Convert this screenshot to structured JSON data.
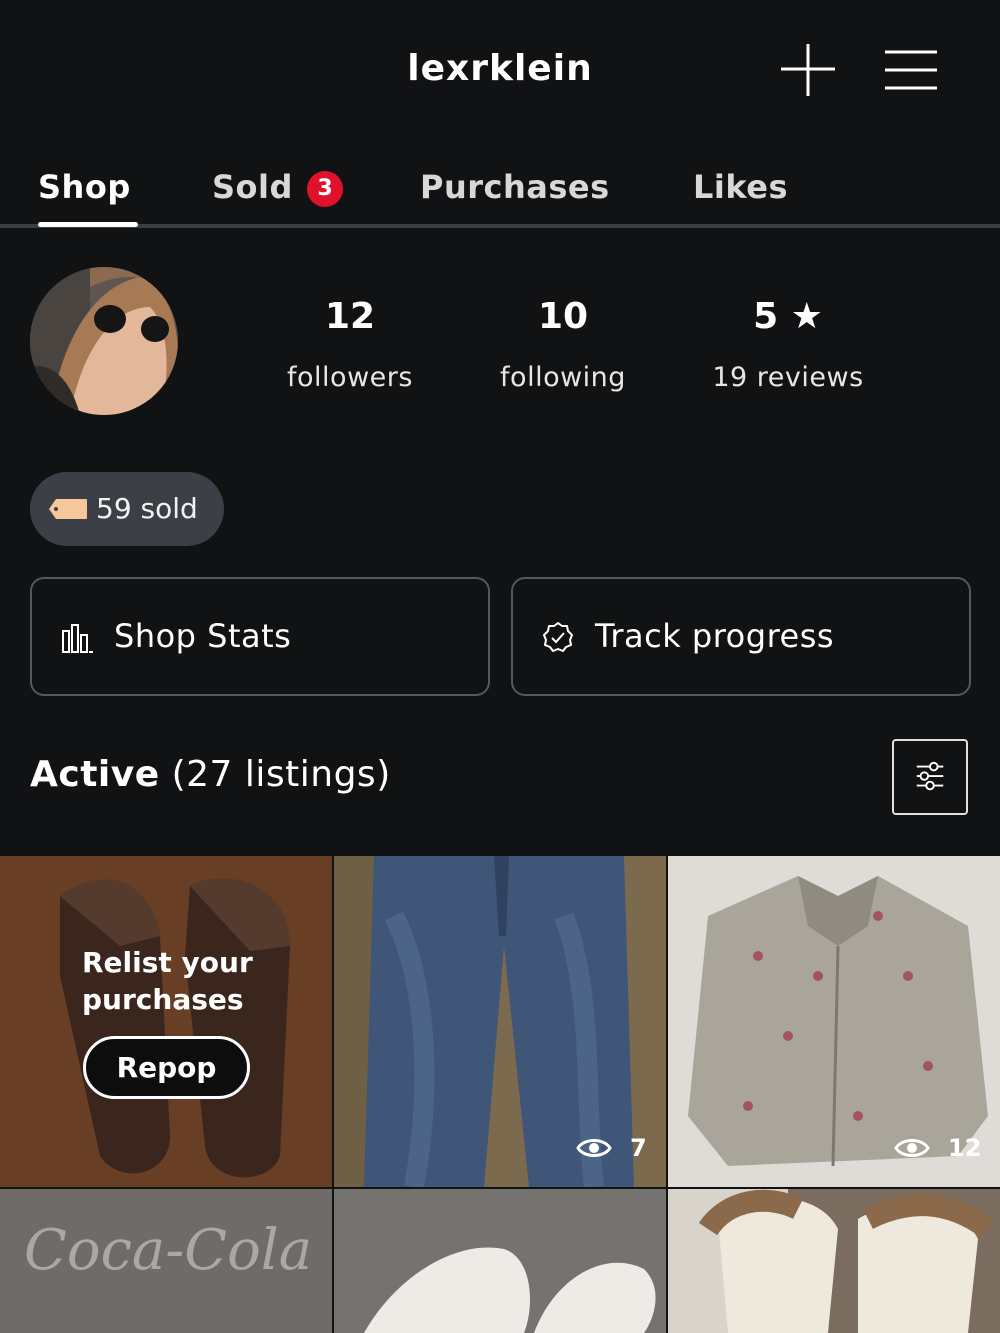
{
  "header": {
    "username": "lexrklein",
    "add_icon": "plus-icon",
    "menu_icon": "hamburger-menu-icon"
  },
  "tabs": [
    {
      "label": "Shop",
      "active": true
    },
    {
      "label": "Sold",
      "badge": "3"
    },
    {
      "label": "Purchases"
    },
    {
      "label": "Likes"
    }
  ],
  "profile": {
    "stats": [
      {
        "value": "12",
        "label": "followers"
      },
      {
        "value": "10",
        "label": "following"
      },
      {
        "value": "5 ★",
        "label": "19 reviews"
      }
    ],
    "sold_pill": "59 sold"
  },
  "actions": {
    "shop_stats": "Shop Stats",
    "track_progress": "Track progress"
  },
  "listings": {
    "heading_bold": "Active",
    "heading_count": "(27 listings)",
    "relist_text": "Relist your purchases",
    "repop_label": "Repop",
    "tiles": [
      {
        "item": "brown suede shoes"
      },
      {
        "item": "blue jeans",
        "views": "7"
      },
      {
        "item": "floral denim jacket",
        "views": "12"
      },
      {
        "item": "Coca-Cola shirt",
        "logo_text": "Coca-Cola"
      },
      {
        "item": "white sneakers"
      },
      {
        "item": "fur-trimmed boots"
      }
    ]
  },
  "colors": {
    "background": "#111214",
    "badge": "#e0112b",
    "pill": "#3c3f45",
    "border": "#54575d"
  }
}
